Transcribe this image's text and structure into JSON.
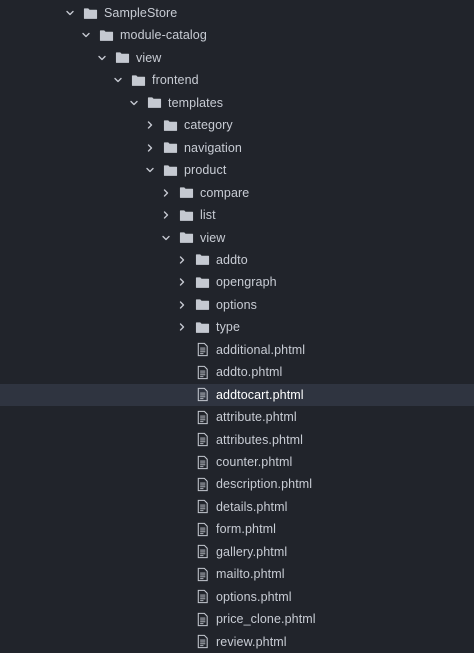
{
  "colors": {
    "background": "#21242b",
    "selection": "#2f3440",
    "text": "#c8ccd4",
    "icon": "#c5c9d1"
  },
  "tree": {
    "items": [
      {
        "label": "SampleStore",
        "kind": "folder",
        "expanded": true,
        "depth": 0,
        "icon": "folder-icon"
      },
      {
        "label": "module-catalog",
        "kind": "folder",
        "expanded": true,
        "depth": 1,
        "icon": "folder-icon"
      },
      {
        "label": "view",
        "kind": "folder",
        "expanded": true,
        "depth": 2,
        "icon": "folder-icon"
      },
      {
        "label": "frontend",
        "kind": "folder",
        "expanded": true,
        "depth": 3,
        "icon": "folder-icon"
      },
      {
        "label": "templates",
        "kind": "folder",
        "expanded": true,
        "depth": 4,
        "icon": "folder-icon"
      },
      {
        "label": "category",
        "kind": "folder",
        "expanded": false,
        "depth": 5,
        "icon": "folder-icon"
      },
      {
        "label": "navigation",
        "kind": "folder",
        "expanded": false,
        "depth": 5,
        "icon": "folder-icon"
      },
      {
        "label": "product",
        "kind": "folder",
        "expanded": true,
        "depth": 5,
        "icon": "folder-icon"
      },
      {
        "label": "compare",
        "kind": "folder",
        "expanded": false,
        "depth": 6,
        "icon": "folder-icon"
      },
      {
        "label": "list",
        "kind": "folder",
        "expanded": false,
        "depth": 6,
        "icon": "folder-icon"
      },
      {
        "label": "view",
        "kind": "folder",
        "expanded": true,
        "depth": 6,
        "icon": "folder-icon"
      },
      {
        "label": "addto",
        "kind": "folder",
        "expanded": false,
        "depth": 7,
        "icon": "folder-icon"
      },
      {
        "label": "opengraph",
        "kind": "folder",
        "expanded": false,
        "depth": 7,
        "icon": "folder-icon"
      },
      {
        "label": "options",
        "kind": "folder",
        "expanded": false,
        "depth": 7,
        "icon": "folder-icon"
      },
      {
        "label": "type",
        "kind": "folder",
        "expanded": false,
        "depth": 7,
        "icon": "folder-icon"
      },
      {
        "label": "additional.phtml",
        "kind": "file",
        "depth": 7,
        "icon": "file-icon"
      },
      {
        "label": "addto.phtml",
        "kind": "file",
        "depth": 7,
        "icon": "file-icon"
      },
      {
        "label": "addtocart.phtml",
        "kind": "file",
        "depth": 7,
        "icon": "file-icon",
        "selected": true
      },
      {
        "label": "attribute.phtml",
        "kind": "file",
        "depth": 7,
        "icon": "file-icon"
      },
      {
        "label": "attributes.phtml",
        "kind": "file",
        "depth": 7,
        "icon": "file-icon"
      },
      {
        "label": "counter.phtml",
        "kind": "file",
        "depth": 7,
        "icon": "file-icon"
      },
      {
        "label": "description.phtml",
        "kind": "file",
        "depth": 7,
        "icon": "file-icon"
      },
      {
        "label": "details.phtml",
        "kind": "file",
        "depth": 7,
        "icon": "file-icon"
      },
      {
        "label": "form.phtml",
        "kind": "file",
        "depth": 7,
        "icon": "file-icon"
      },
      {
        "label": "gallery.phtml",
        "kind": "file",
        "depth": 7,
        "icon": "file-icon"
      },
      {
        "label": "mailto.phtml",
        "kind": "file",
        "depth": 7,
        "icon": "file-icon"
      },
      {
        "label": "options.phtml",
        "kind": "file",
        "depth": 7,
        "icon": "file-icon"
      },
      {
        "label": "price_clone.phtml",
        "kind": "file",
        "depth": 7,
        "icon": "file-icon"
      },
      {
        "label": "review.phtml",
        "kind": "file",
        "depth": 7,
        "icon": "file-icon"
      }
    ]
  }
}
